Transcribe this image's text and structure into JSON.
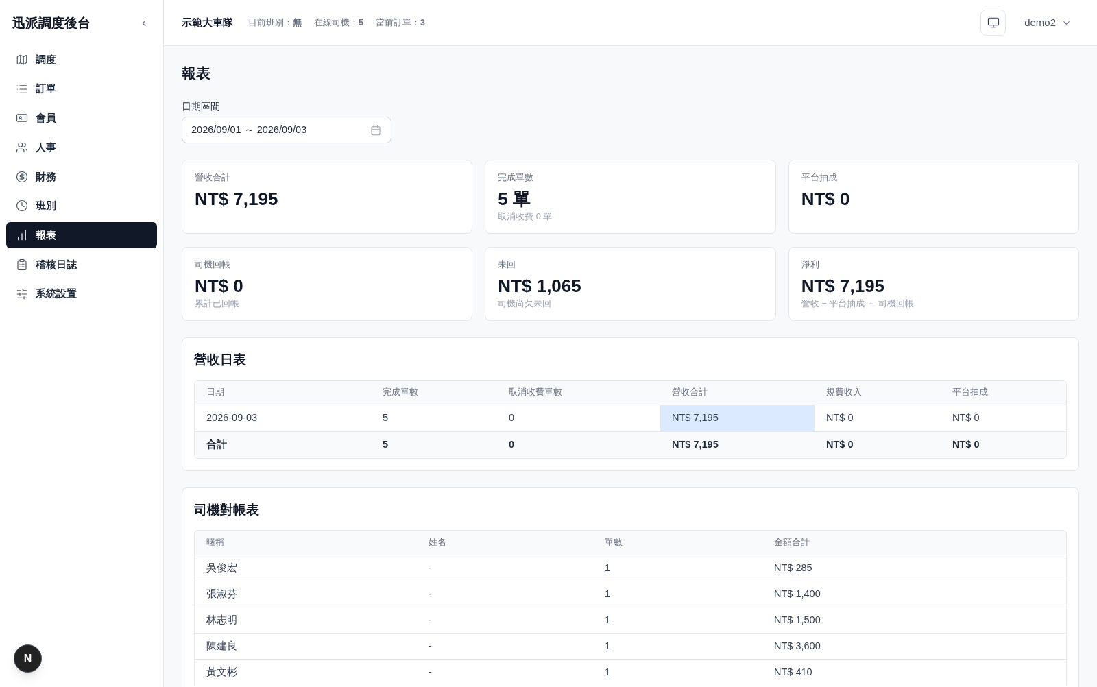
{
  "sidebar": {
    "title": "迅派調度後台",
    "items": [
      {
        "label": "調度",
        "selected": false
      },
      {
        "label": "訂單",
        "selected": false
      },
      {
        "label": "會員",
        "selected": false
      },
      {
        "label": "人事",
        "selected": false
      },
      {
        "label": "財務",
        "selected": false
      },
      {
        "label": "班別",
        "selected": false
      },
      {
        "label": "報表",
        "selected": true
      },
      {
        "label": "稽核日誌",
        "selected": false
      },
      {
        "label": "系統設置",
        "selected": false
      }
    ]
  },
  "header": {
    "fleet": "示範大車隊",
    "stats": [
      "目前班別：**無**",
      "在線司機：**5**",
      "當前訂單：**3**"
    ],
    "user": "demo2"
  },
  "page": {
    "title": "報表",
    "date_range": {
      "label": "日期區間",
      "value": "2026/09/01 ～ 2026/09/03"
    }
  },
  "stat_cards": [
    {
      "label": "營收合計",
      "value": "NT$ 7,195"
    },
    {
      "label": "完成單數",
      "value": "5 單",
      "note": "取消收費 0 單"
    },
    {
      "label": "平台抽成",
      "value": "NT$ 0"
    },
    {
      "label": "司機回帳",
      "value": "NT$ 0",
      "note": "累計已回帳"
    },
    {
      "label": "未回",
      "value": "NT$ 1,065",
      "note": "司機尚欠未回"
    },
    {
      "label": "淨利",
      "value": "NT$ 7,195",
      "note": "營收 − 平台抽成 ＋ 司機回帳"
    }
  ],
  "daily_table": {
    "title": "營收日表",
    "columns": [
      "日期",
      "完成單數",
      "取消收費單數",
      "營收合計",
      "規費收入",
      "平台抽成"
    ],
    "rows": [
      {
        "cells": [
          {
            "text": "2026-09-03",
            "selected": false
          },
          {
            "text": "5",
            "selected": false
          },
          {
            "text": "0",
            "selected": false
          },
          {
            "text": "NT$ 7,195",
            "selected": true
          },
          {
            "text": "NT$ 0",
            "selected": false
          },
          {
            "text": "NT$ 0",
            "selected": false
          }
        ]
      }
    ],
    "total": [
      "合計",
      "5",
      "0",
      "NT$ 7,195",
      "NT$ 0",
      "NT$ 0"
    ]
  },
  "driver_table": {
    "title": "司機對帳表",
    "columns": [
      "暱稱",
      "姓名",
      "單數",
      "金額合計"
    ],
    "rows": [
      [
        "吳俊宏",
        "-",
        "1",
        "NT$ 285"
      ],
      [
        "張淑芬",
        "-",
        "1",
        "NT$ 1,400"
      ],
      [
        "林志明",
        "-",
        "1",
        "NT$ 1,500"
      ],
      [
        "陳建良",
        "-",
        "1",
        "NT$ 3,600"
      ],
      [
        "黃文彬",
        "-",
        "1",
        "NT$ 410"
      ]
    ]
  },
  "dev_badge": {
    "label": "N"
  }
}
